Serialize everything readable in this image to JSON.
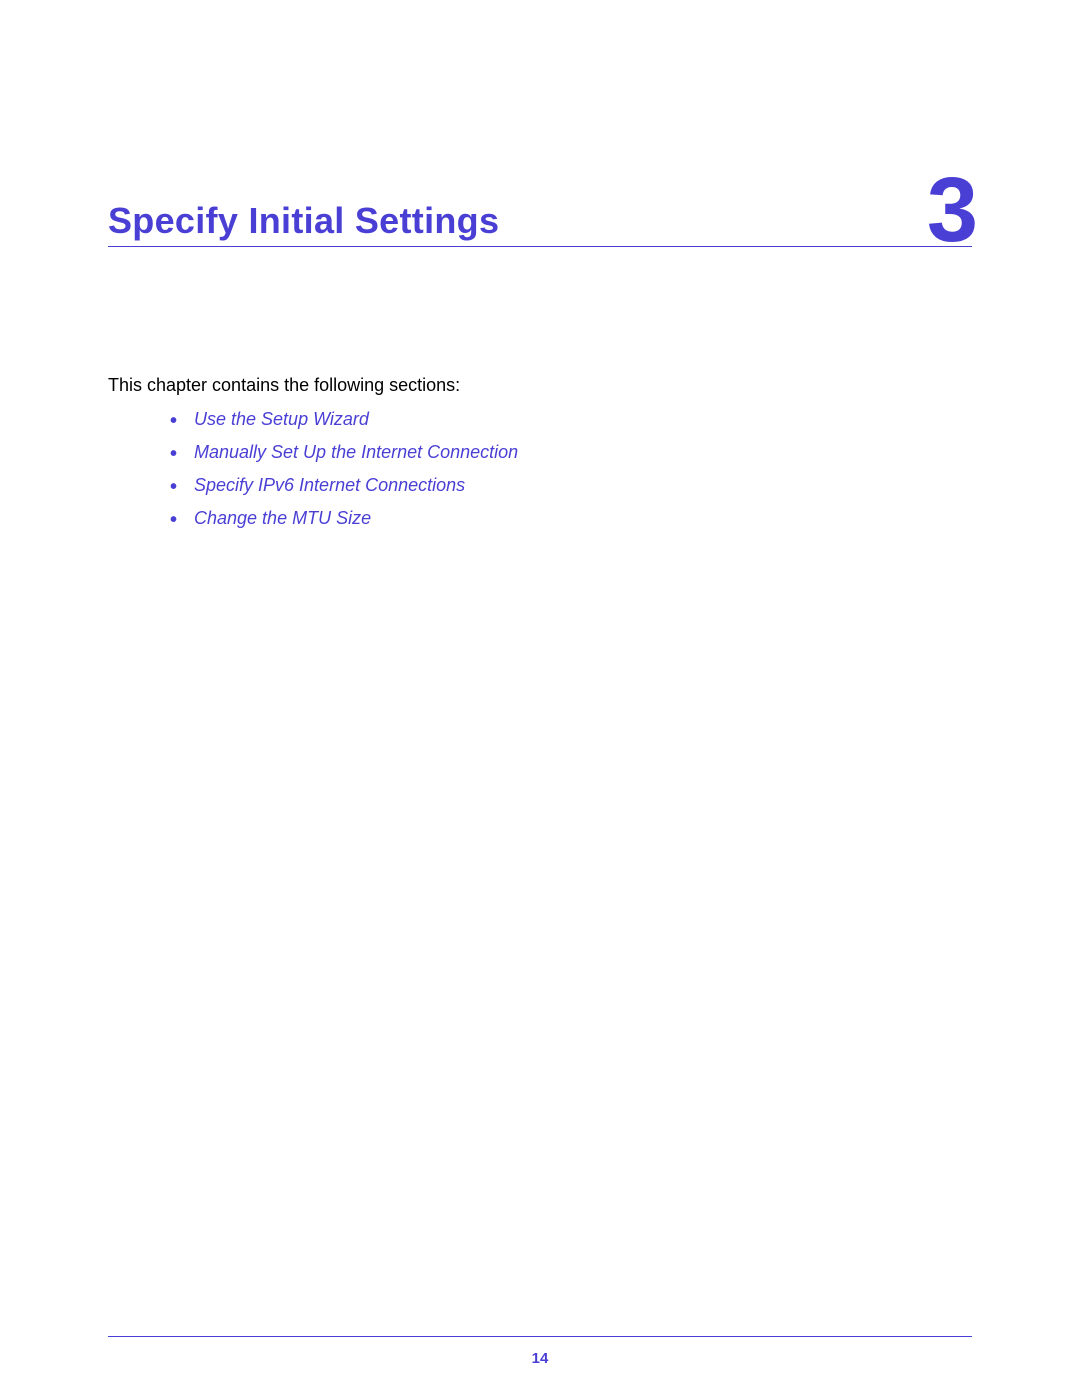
{
  "chapter": {
    "title": "Specify Initial Settings",
    "number": "3"
  },
  "intro": "This chapter contains the following sections:",
  "sections": [
    "Use the Setup Wizard",
    "Manually Set Up the Internet Connection",
    "Specify IPv6 Internet Connections",
    "Change the MTU Size"
  ],
  "page_number": "14"
}
